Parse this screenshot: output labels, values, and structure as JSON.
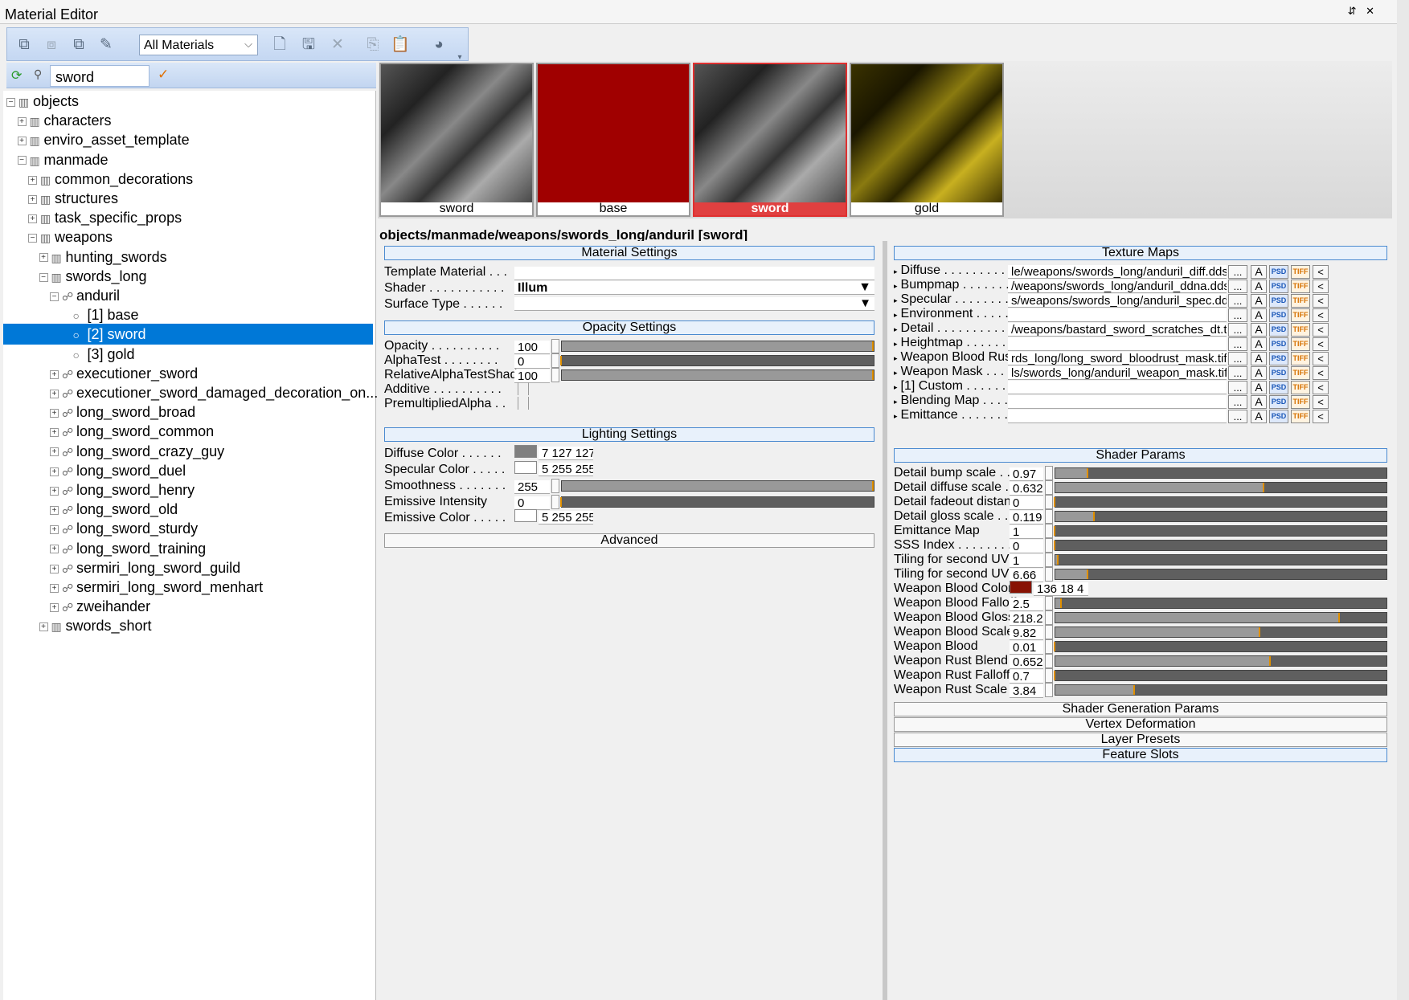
{
  "window": {
    "title": "Material Editor",
    "pin": "⇵ ✕"
  },
  "toolbar": {
    "filter": "All Materials"
  },
  "search": {
    "query": "sword"
  },
  "tree": [
    {
      "label": "objects",
      "depth": 0,
      "pm": "−",
      "icon": "folder"
    },
    {
      "label": "characters",
      "depth": 1,
      "pm": "+",
      "icon": "folder"
    },
    {
      "label": "enviro_asset_template",
      "depth": 1,
      "pm": "+",
      "icon": "folder"
    },
    {
      "label": "manmade",
      "depth": 1,
      "pm": "−",
      "icon": "folder"
    },
    {
      "label": "common_decorations",
      "depth": 2,
      "pm": "+",
      "icon": "folder"
    },
    {
      "label": "structures",
      "depth": 2,
      "pm": "+",
      "icon": "folder"
    },
    {
      "label": "task_specific_props",
      "depth": 2,
      "pm": "+",
      "icon": "folder"
    },
    {
      "label": "weapons",
      "depth": 2,
      "pm": "−",
      "icon": "folder"
    },
    {
      "label": "hunting_swords",
      "depth": 3,
      "pm": "+",
      "icon": "folder"
    },
    {
      "label": "swords_long",
      "depth": 3,
      "pm": "−",
      "icon": "folder"
    },
    {
      "label": "anduril",
      "depth": 4,
      "pm": "−",
      "icon": "material"
    },
    {
      "label": "[1] base",
      "depth": 5,
      "pm": "",
      "icon": "submat"
    },
    {
      "label": "[2] sword",
      "depth": 5,
      "pm": "",
      "icon": "submat",
      "selected": true
    },
    {
      "label": "[3] gold",
      "depth": 5,
      "pm": "",
      "icon": "submat"
    },
    {
      "label": "executioner_sword",
      "depth": 4,
      "pm": "+",
      "icon": "material"
    },
    {
      "label": "executioner_sword_damaged_decoration_on...",
      "depth": 4,
      "pm": "+",
      "icon": "material"
    },
    {
      "label": "long_sword_broad",
      "depth": 4,
      "pm": "+",
      "icon": "material"
    },
    {
      "label": "long_sword_common",
      "depth": 4,
      "pm": "+",
      "icon": "material"
    },
    {
      "label": "long_sword_crazy_guy",
      "depth": 4,
      "pm": "+",
      "icon": "material"
    },
    {
      "label": "long_sword_duel",
      "depth": 4,
      "pm": "+",
      "icon": "material"
    },
    {
      "label": "long_sword_henry",
      "depth": 4,
      "pm": "+",
      "icon": "material"
    },
    {
      "label": "long_sword_old",
      "depth": 4,
      "pm": "+",
      "icon": "material"
    },
    {
      "label": "long_sword_sturdy",
      "depth": 4,
      "pm": "+",
      "icon": "material"
    },
    {
      "label": "long_sword_training",
      "depth": 4,
      "pm": "+",
      "icon": "material"
    },
    {
      "label": "sermiri_long_sword_guild",
      "depth": 4,
      "pm": "+",
      "icon": "material"
    },
    {
      "label": "sermiri_long_sword_menhart",
      "depth": 4,
      "pm": "+",
      "icon": "material"
    },
    {
      "label": "zweihander",
      "depth": 4,
      "pm": "+",
      "icon": "material"
    },
    {
      "label": "swords_short",
      "depth": 3,
      "pm": "+",
      "icon": "folder"
    }
  ],
  "previews": [
    {
      "label": "sword",
      "kind": "gray"
    },
    {
      "label": "base",
      "kind": "red"
    },
    {
      "label": "sword",
      "kind": "gray",
      "selected": true
    },
    {
      "label": "gold",
      "kind": "gold"
    }
  ],
  "path": "objects/manmade/weapons/swords_long/anduril [sword]",
  "material": {
    "header": "Material Settings",
    "template_label": "Template Material . . .",
    "shader_label": "Shader . . . . . . . . . . .",
    "shader_value": "Illum",
    "surface_label": "Surface Type . . . . . ."
  },
  "opacity": {
    "header": "Opacity Settings",
    "rows": [
      {
        "label": "Opacity . . . . . . . . . .",
        "value": "100",
        "fill": 1.0
      },
      {
        "label": "AlphaTest . . . . . . . .",
        "value": "0",
        "fill": 0.0
      },
      {
        "label": "RelativeAlphaTestShad",
        "value": "100",
        "fill": 1.0
      }
    ],
    "checks": [
      {
        "label": "Additive . . . . . . . . . ."
      },
      {
        "label": "PremultipliedAlpha . ."
      }
    ]
  },
  "lighting": {
    "header": "Lighting Settings",
    "diffuse_label": "Diffuse Color . . . . . .",
    "diffuse_value": "7 127 127",
    "diffuse_color": "#7f7f7f",
    "specular_label": "Specular Color . . . . .",
    "specular_value": "5 255 255",
    "specular_color": "#ffffff",
    "smooth_label": "Smoothness . . . . . . .",
    "smooth_value": "255",
    "smooth_fill": 1.0,
    "emint_label": "Emissive Intensity",
    "emint_value": "0",
    "emint_fill": 0.0,
    "emcol_label": "Emissive Color . . . . .",
    "emcol_value": "5 255 255",
    "emcol_color": "#ffffff"
  },
  "advanced": "Advanced",
  "textures": {
    "header": "Texture Maps",
    "rows": [
      {
        "label": "Diffuse . . . . . . . . .",
        "value": "le/weapons/swords_long/anduril_diff.dds"
      },
      {
        "label": "Bumpmap . . . . . . .",
        "value": "/weapons/swords_long/anduril_ddna.dds"
      },
      {
        "label": "Specular . . . . . . . .",
        "value": "s/weapons/swords_long/anduril_spec.dds"
      },
      {
        "label": "Environment . . . . .",
        "value": ""
      },
      {
        "label": "Detail . . . . . . . . . .",
        "value": "/weapons/bastard_sword_scratches_dt.tif"
      },
      {
        "label": "Heightmap . . . . . . .",
        "value": ""
      },
      {
        "label": "Weapon Blood Rust .",
        "value": "rds_long/long_sword_bloodrust_mask.tif"
      },
      {
        "label": "Weapon Mask . . . . .",
        "value": "ls/swords_long/anduril_weapon_mask.tif"
      },
      {
        "label": "[1] Custom . . . . . .",
        "value": ""
      },
      {
        "label": "Blending Map . . . . .",
        "value": ""
      },
      {
        "label": "Emittance . . . . . . .",
        "value": ""
      }
    ],
    "btn_more": "...",
    "btn_a": "A",
    "btn_psd": "PSD",
    "btn_tiff": "TIFF",
    "btn_back": "<"
  },
  "shader_params": {
    "header": "Shader Params",
    "rows": [
      {
        "label": "Detail bump scale . . .",
        "value": "0.97",
        "fill": 0.1
      },
      {
        "label": "Detail diffuse scale . .",
        "value": "0.632",
        "fill": 0.63
      },
      {
        "label": "Detail fadeout distance",
        "value": "0",
        "fill": 0.0
      },
      {
        "label": "Detail gloss scale . . . .",
        "value": "0.119",
        "fill": 0.12
      },
      {
        "label": "Emittance Map",
        "value": "1",
        "fill": 0.0
      },
      {
        "label": "SSS Index . . . . . . . .",
        "value": "0",
        "fill": 0.0
      },
      {
        "label": "Tiling for second UVs",
        "value": "1",
        "fill": 0.01
      },
      {
        "label": "Tiling for second UVs",
        "value": "6.66",
        "fill": 0.1
      },
      {
        "label": "Weapon Blood Color .",
        "value": "136 18 4",
        "color": "#881204"
      },
      {
        "label": "Weapon Blood Falloff",
        "value": "2.5",
        "fill": 0.02
      },
      {
        "label": "Weapon Blood Gloss .",
        "value": "218.2",
        "fill": 0.86
      },
      {
        "label": "Weapon Blood Scale .",
        "value": "9.82",
        "fill": 0.62
      },
      {
        "label": "Weapon Blood",
        "value": "0.01",
        "fill": 0.0
      },
      {
        "label": "Weapon Rust Blend . .",
        "value": "0.652",
        "fill": 0.65
      },
      {
        "label": "Weapon Rust Falloff .",
        "value": "0.7",
        "fill": 0.0
      },
      {
        "label": "Weapon Rust Scale . .",
        "value": "3.84",
        "fill": 0.24
      }
    ]
  },
  "collapsed": [
    {
      "label": "Shader Generation Params",
      "style": "plain"
    },
    {
      "label": "Vertex Deformation",
      "style": "plain"
    },
    {
      "label": "Layer Presets",
      "style": "plain"
    },
    {
      "label": "Feature Slots",
      "style": "blue"
    }
  ]
}
